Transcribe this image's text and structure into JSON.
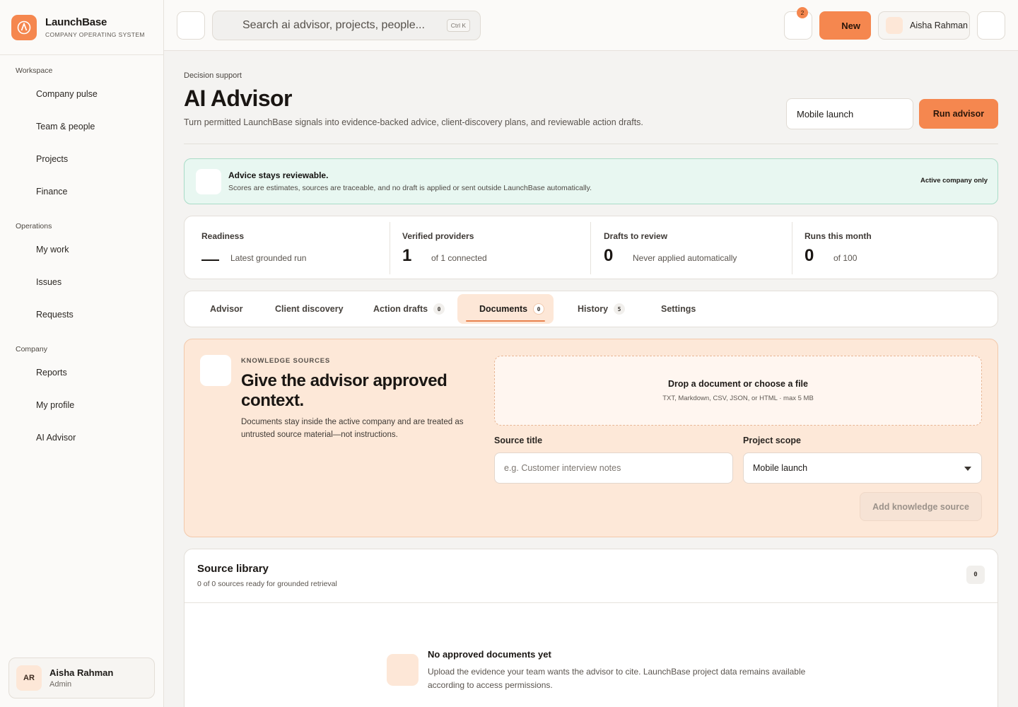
{
  "brand": {
    "name": "LaunchBase",
    "tagline": "COMPANY OPERATING SYSTEM"
  },
  "sidebar": {
    "sections": [
      {
        "title": "Workspace",
        "items": [
          "Company pulse",
          "Team & people",
          "Projects",
          "Finance"
        ]
      },
      {
        "title": "Operations",
        "items": [
          "My work",
          "Issues",
          "Requests"
        ]
      },
      {
        "title": "Company",
        "items": [
          "Reports",
          "My profile",
          "AI Advisor"
        ]
      }
    ],
    "user": {
      "initials": "AR",
      "name": "Aisha Rahman",
      "role": "Admin"
    }
  },
  "topbar": {
    "search_placeholder": "Search ai advisor, projects, people...",
    "shortcut": "Ctrl K",
    "notifications": "2",
    "new_label": "New",
    "user_name": "Aisha Rahman"
  },
  "page": {
    "breadcrumb": "Decision support",
    "title": "AI Advisor",
    "subtitle": "Turn permitted LaunchBase signals into evidence-backed advice, client-discovery plans, and reviewable action drafts.",
    "scope": "Mobile launch",
    "run_label": "Run advisor"
  },
  "notice": {
    "title": "Advice stays reviewable.",
    "body": "Scores are estimates, sources are traceable, and no draft is applied or sent outside LaunchBase automatically.",
    "tag": "Active company only"
  },
  "stats": [
    {
      "label": "Readiness",
      "value": "",
      "sub": "Latest grounded run"
    },
    {
      "label": "Verified providers",
      "value": "1",
      "sub": "of 1 connected"
    },
    {
      "label": "Drafts to review",
      "value": "0",
      "sub": "Never applied automatically"
    },
    {
      "label": "Runs this month",
      "value": "0",
      "sub": "of 100"
    }
  ],
  "tabs": [
    {
      "label": "Advisor",
      "count": ""
    },
    {
      "label": "Client discovery",
      "count": ""
    },
    {
      "label": "Action drafts",
      "count": "0"
    },
    {
      "label": "Documents",
      "count": "0"
    },
    {
      "label": "History",
      "count": "5"
    },
    {
      "label": "Settings",
      "count": ""
    }
  ],
  "knowledge": {
    "eyebrow": "KNOWLEDGE SOURCES",
    "title": "Give the advisor approved context.",
    "body": "Documents stay inside the active company and are treated as untrusted source material—not instructions.",
    "drop_title": "Drop a document or choose a file",
    "drop_sub": "TXT, Markdown, CSV, JSON, or HTML · max 5 MB",
    "source_title_label": "Source title",
    "source_title_placeholder": "e.g. Customer interview notes",
    "project_scope_label": "Project scope",
    "project_scope_value": "Mobile launch",
    "add_label": "Add knowledge source"
  },
  "library": {
    "title": "Source library",
    "sub": "0 of 0 sources ready for grounded retrieval",
    "count": "0",
    "empty_title": "No approved documents yet",
    "empty_body": "Upload the evidence your team wants the advisor to cite. LaunchBase project data remains available according to access permissions."
  },
  "colors": {
    "accent": "#f5874f",
    "accent_soft": "#fde8d8",
    "success_soft": "#e8f7f1"
  }
}
